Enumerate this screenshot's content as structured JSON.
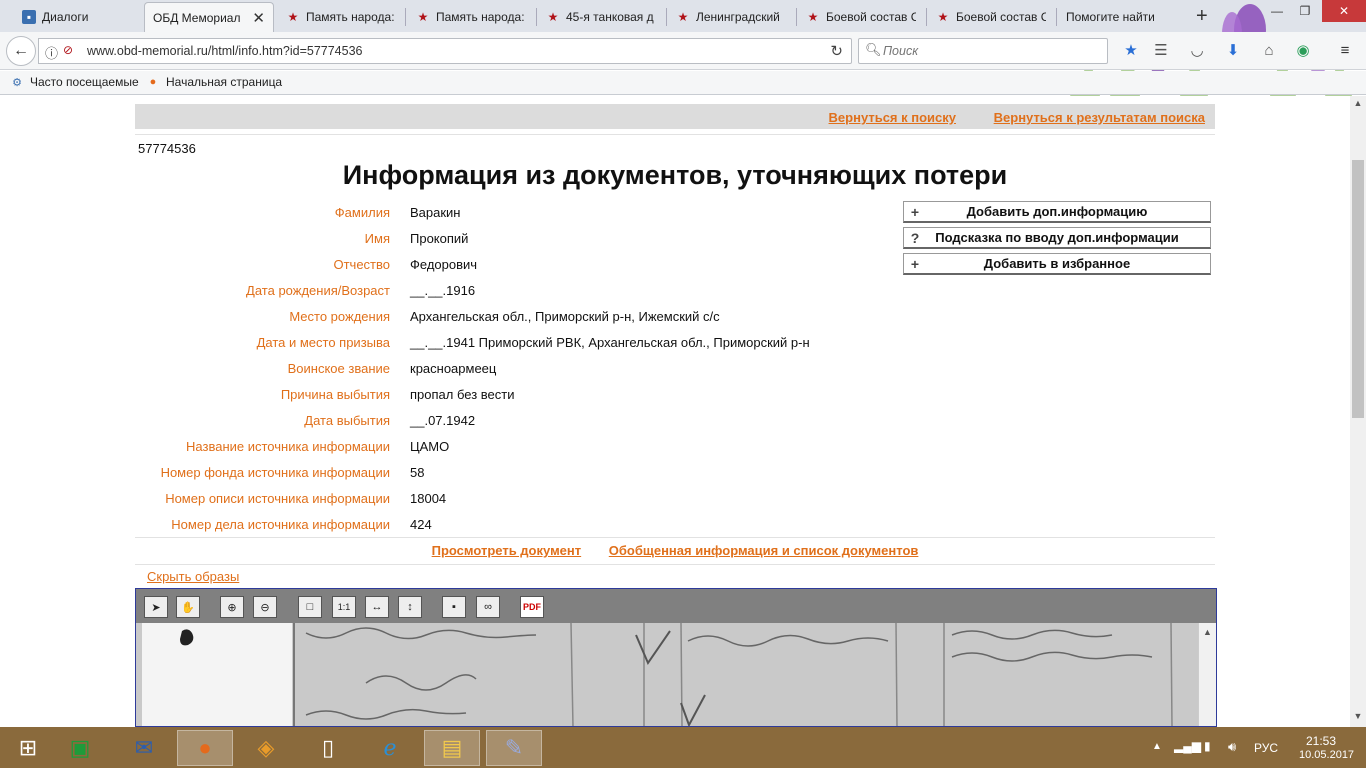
{
  "tabs": [
    {
      "label": "Диалоги",
      "icon": "dialog-icon"
    },
    {
      "label": "ОБД Мемориал",
      "icon": "none",
      "active": true
    },
    {
      "label": "Память народа:",
      "icon": "star-icon"
    },
    {
      "label": "Память народа:",
      "icon": "star-icon"
    },
    {
      "label": "45-я танковая д",
      "icon": "star-icon"
    },
    {
      "label": "Ленинградский",
      "icon": "star-icon"
    },
    {
      "label": "Боевой состав С",
      "icon": "star-icon"
    },
    {
      "label": "Боевой состав С",
      "icon": "star-icon"
    },
    {
      "label": "Помогите найти",
      "icon": "none"
    }
  ],
  "navbar": {
    "url": "www.obd-memorial.ru/html/info.htm?id=57774536",
    "search_placeholder": "Поиск"
  },
  "bookmarks": [
    {
      "label": "Часто посещаемые"
    },
    {
      "label": "Начальная страница"
    }
  ],
  "page": {
    "top_links": {
      "back_to_search": "Вернуться к поиску",
      "back_to_results": "Вернуться к результатам поиска"
    },
    "record_id": "57774536",
    "title": "Информация из документов, уточняющих потери",
    "fields": [
      {
        "label": "Фамилия",
        "value": "Варакин"
      },
      {
        "label": "Имя",
        "value": "Прокопий"
      },
      {
        "label": "Отчество",
        "value": "Федорович"
      },
      {
        "label": "Дата рождения/Возраст",
        "value": "__.__.1916"
      },
      {
        "label": "Место рождения",
        "value": "Архангельская обл., Приморский р-н, Ижемский с/с"
      },
      {
        "label": "Дата и место призыва",
        "value": "__.__.1941 Приморский РВК, Архангельская обл., Приморский р-н"
      },
      {
        "label": "Воинское звание",
        "value": "красноармеец"
      },
      {
        "label": "Причина выбытия",
        "value": "пропал без вести"
      },
      {
        "label": "Дата выбытия",
        "value": "__.07.1942"
      },
      {
        "label": "Название источника информации",
        "value": "ЦАМО"
      },
      {
        "label": "Номер фонда источника информации",
        "value": "58"
      },
      {
        "label": "Номер описи источника информации",
        "value": "18004"
      },
      {
        "label": "Номер дела источника информации",
        "value": "424"
      }
    ],
    "side_buttons": [
      {
        "icon": "+",
        "label": "Добавить доп.информацию"
      },
      {
        "icon": "?",
        "label": "Подсказка по вводу доп.информации"
      },
      {
        "icon": "+",
        "label": "Добавить в избранное"
      }
    ],
    "doc_links": {
      "view_document": "Просмотреть документ",
      "summary": "Обобщенная информация и список документов"
    },
    "hide_images": "Скрыть образы"
  },
  "taskbar": {
    "language": "РУС",
    "time": "21:53",
    "date": "10.05.2017"
  },
  "colors": {
    "accent_orange": "#e0701b",
    "taskbar": "#8a6a3c",
    "viewer_border": "#2e3a9a"
  }
}
